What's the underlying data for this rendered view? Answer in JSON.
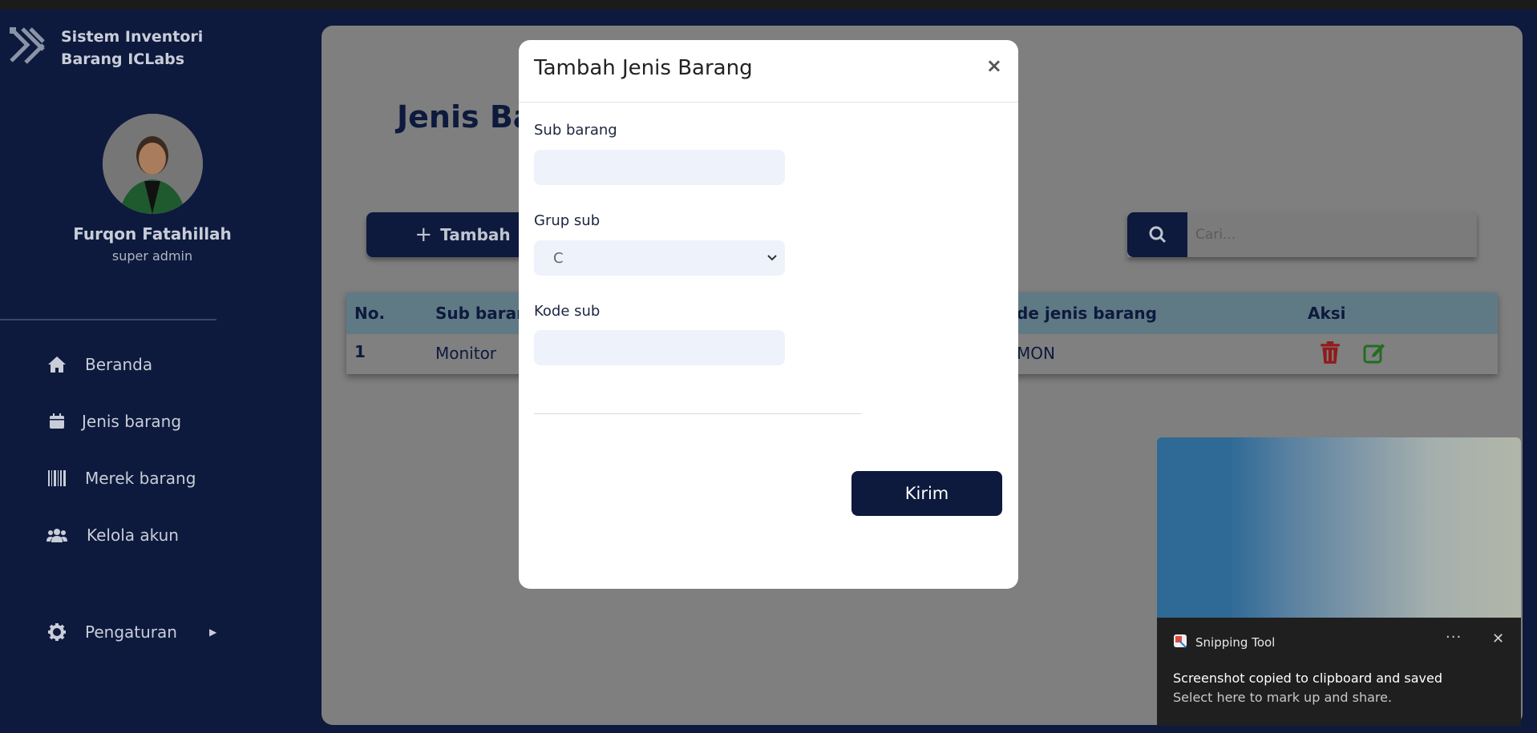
{
  "sidebar": {
    "brand": "Sistem Inventori Barang ICLabs",
    "user_name": "Furqon Fatahillah",
    "user_role": "super admin",
    "nav": [
      {
        "label": "Beranda",
        "icon": "home-icon"
      },
      {
        "label": "Jenis barang",
        "icon": "calendar-icon"
      },
      {
        "label": "Merek barang",
        "icon": "barcode-icon"
      },
      {
        "label": "Kelola akun",
        "icon": "users-icon"
      },
      {
        "label": "Pengaturan",
        "icon": "gear-icon"
      }
    ]
  },
  "main": {
    "page_title": "Jenis Bar",
    "add_label": "Tambah",
    "search_placeholder": "Cari...",
    "table": {
      "headers": [
        "No.",
        "Sub baran",
        "de jenis barang",
        "Aksi"
      ],
      "rows": [
        {
          "no": "1",
          "sub": "Monitor",
          "kode": "MON"
        }
      ]
    }
  },
  "modal": {
    "title": "Tambah Jenis Barang",
    "close": "×",
    "field1_label": "Sub barang",
    "field2_label": "Grup sub",
    "field2_value": "C",
    "field3_label": "Kode sub",
    "submit_label": "Kirim"
  },
  "toast": {
    "app": "Snipping Tool",
    "message": "Screenshot copied to clipboard and saved",
    "sub": "Select here to mark up and share.",
    "more": "···",
    "close": "✕"
  },
  "colors": {
    "navy": "#0d1a3d",
    "overlay_gray": "#7f7f7f",
    "delete_red": "#c62828",
    "edit_green": "#2e9d2e"
  }
}
